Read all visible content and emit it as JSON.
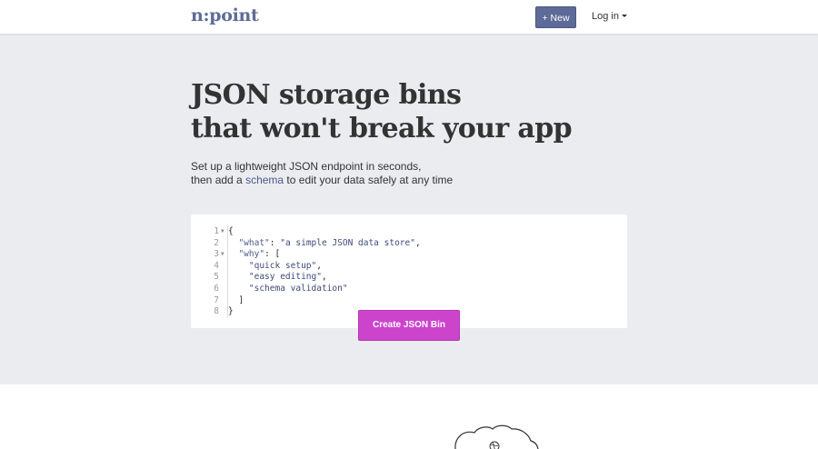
{
  "brand": {
    "logo": "n:point",
    "accent": "#5d6b98",
    "cta_color": "#cc44cc"
  },
  "nav": {
    "new_label": "+ New",
    "login_label": "Log in"
  },
  "hero": {
    "headline_line1": "JSON storage bins",
    "headline_line2": "that won't break your app",
    "subtitle_line1": "Set up a lightweight JSON endpoint in seconds,",
    "subtitle_line2_pre": "then add a ",
    "subtitle_link": "schema",
    "subtitle_line2_post": " to edit your data safely at any time"
  },
  "editor": {
    "lines": [
      {
        "num": "1",
        "fold": true,
        "tokens": [
          {
            "t": "{",
            "c": "p"
          }
        ]
      },
      {
        "num": "2",
        "fold": false,
        "tokens": [
          {
            "t": "  ",
            "c": "p"
          },
          {
            "t": "\"what\"",
            "c": "k"
          },
          {
            "t": ": ",
            "c": "p"
          },
          {
            "t": "\"a simple JSON data store\"",
            "c": "s"
          },
          {
            "t": ",",
            "c": "p"
          }
        ]
      },
      {
        "num": "3",
        "fold": true,
        "tokens": [
          {
            "t": "  ",
            "c": "p"
          },
          {
            "t": "\"why\"",
            "c": "k"
          },
          {
            "t": ": [",
            "c": "p"
          }
        ]
      },
      {
        "num": "4",
        "fold": false,
        "tokens": [
          {
            "t": "    ",
            "c": "p"
          },
          {
            "t": "\"quick setup\"",
            "c": "s"
          },
          {
            "t": ",",
            "c": "p"
          }
        ]
      },
      {
        "num": "5",
        "fold": false,
        "tokens": [
          {
            "t": "    ",
            "c": "p"
          },
          {
            "t": "\"easy editing\"",
            "c": "s"
          },
          {
            "t": ",",
            "c": "p"
          }
        ]
      },
      {
        "num": "6",
        "fold": false,
        "tokens": [
          {
            "t": "    ",
            "c": "p"
          },
          {
            "t": "\"schema validation\"",
            "c": "s"
          }
        ]
      },
      {
        "num": "7",
        "fold": false,
        "tokens": [
          {
            "t": "  ]",
            "c": "p"
          }
        ]
      },
      {
        "num": "8",
        "fold": false,
        "tokens": [
          {
            "t": "}",
            "c": "p"
          }
        ]
      }
    ]
  },
  "cta": {
    "label": "Create JSON Bin"
  },
  "icons": {
    "fold": "triangle-down-icon",
    "caret": "caret-down-icon",
    "illustration": "cloud-globe-illustration"
  }
}
